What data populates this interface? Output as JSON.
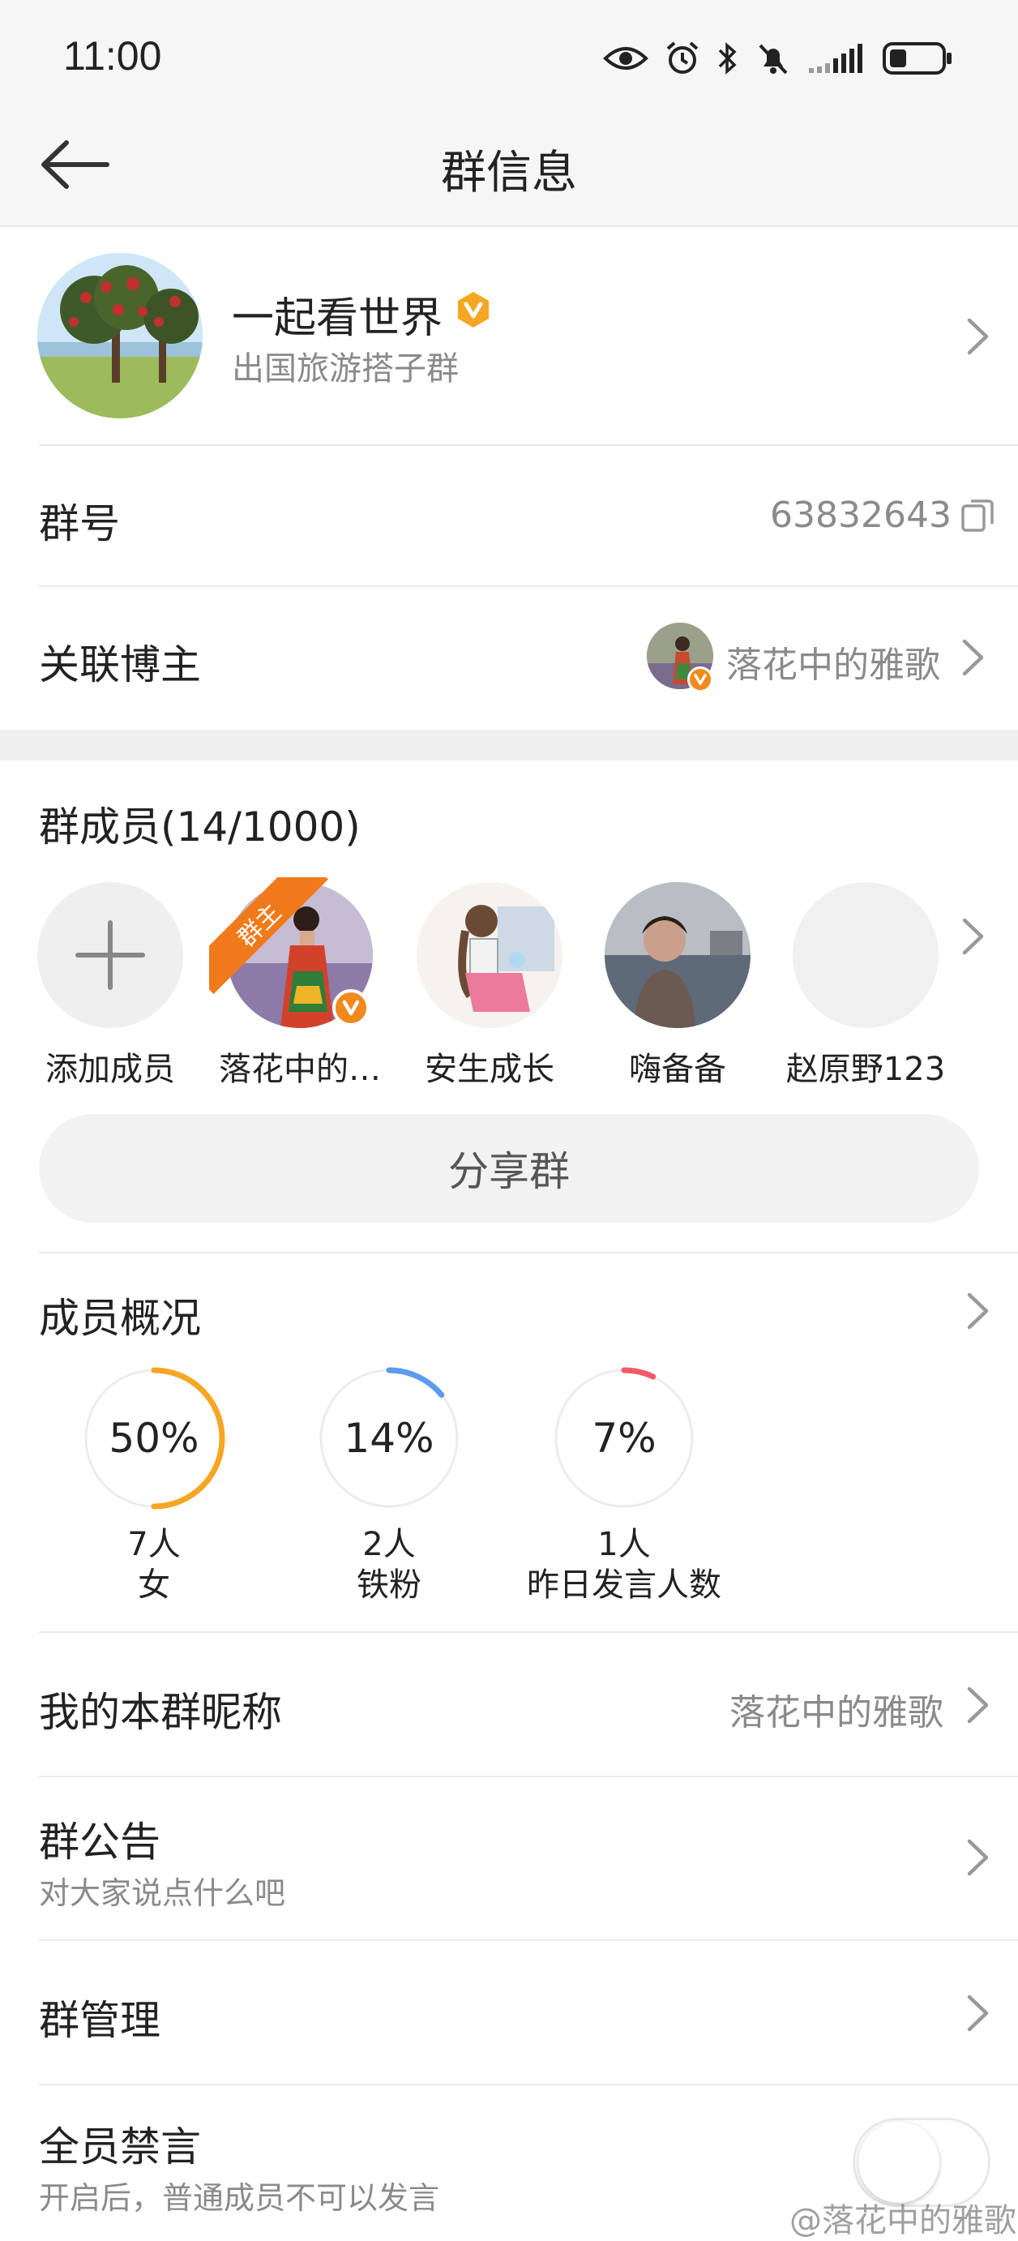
{
  "status_bar": {
    "time": "11:00"
  },
  "nav": {
    "title": "群信息"
  },
  "group": {
    "name": "一起看世界",
    "subtitle": "出国旅游搭子群"
  },
  "group_number": {
    "label": "群号",
    "value": "63832643"
  },
  "linked_blogger": {
    "label": "关联博主",
    "name": "落花中的雅歌"
  },
  "members": {
    "title": "群成员(14/1000)",
    "owner_badge": "群主",
    "items": [
      {
        "name": "添加成员"
      },
      {
        "name": "落花中的…"
      },
      {
        "name": "安生成长"
      },
      {
        "name": "嗨备备"
      },
      {
        "name": "赵原野123"
      }
    ]
  },
  "share_button": "分享群",
  "overview": {
    "title": "成员概况",
    "stats": [
      {
        "percent_text": "50%",
        "percent": 50,
        "count": "7人",
        "label": "女",
        "color": "#f5a623"
      },
      {
        "percent_text": "14%",
        "percent": 14,
        "count": "2人",
        "label": "铁粉",
        "color": "#5b9bf0"
      },
      {
        "percent_text": "7%",
        "percent": 7,
        "count": "1人",
        "label": "昨日发言人数",
        "color": "#f25a68"
      }
    ]
  },
  "nickname": {
    "label": "我的本群昵称",
    "value": "落花中的雅歌"
  },
  "announcement": {
    "label": "群公告",
    "placeholder": "对大家说点什么吧"
  },
  "management": {
    "label": "群管理"
  },
  "mute_all": {
    "label": "全员禁言",
    "hint": "开启后，普通成员不可以发言",
    "enabled": false
  },
  "watermark": "@落花中的雅歌",
  "colors": {
    "accent": "#f5a623",
    "verified_badge": "#f08a1c",
    "text_secondary": "#8a8a8a"
  }
}
